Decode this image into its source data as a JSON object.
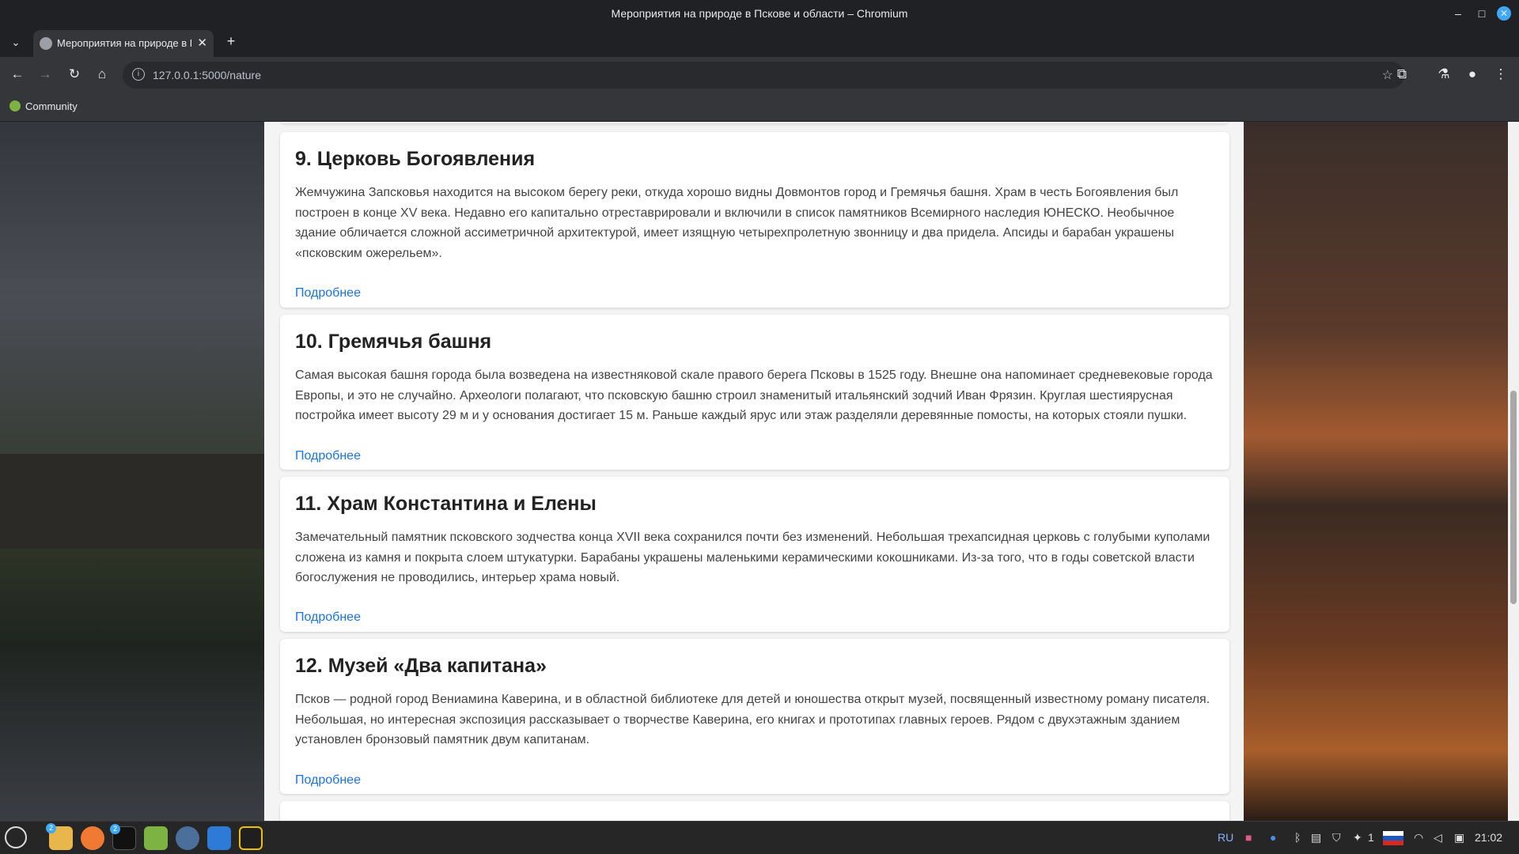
{
  "window": {
    "title": "Мероприятия на природе в Пскове и области – Chromium"
  },
  "tab": {
    "label": "Мероприятия на природе в Пскове и области"
  },
  "toolbar": {
    "url": "127.0.0.1:5000/nature"
  },
  "bookmarks": {
    "community": "Community"
  },
  "cards": [
    {
      "title": "9. Церковь Богоявления",
      "text": "Жемчужина Запсковья находится на высоком берегу реки, откуда хорошо видны Довмонтов город и Гремячья башня. Храм в честь Богоявления был построен в конце XV века. Недавно его капитально отреставрировали и включили в список памятников Всемирного наследия ЮНЕСКО. Необычное здание обличается сложной ассиметричной архитектурой, имеет изящную четырехпролетную звонницу и два придела. Апсиды и барабан украшены «псковским ожерельем».",
      "link": "Подробнее"
    },
    {
      "title": "10. Гремячья башня",
      "text": "Самая высокая башня города была возведена на известняковой скале правого берега Псковы в 1525 году. Внешне она напоминает средневековые города Европы, и это не случайно. Археологи полагают, что псковскую башню строил знаменитый итальянский зодчий Иван Фрязин. Круглая шестиярусная постройка имеет высоту 29 м и у основания достигает 15 м. Раньше каждый ярус или этаж разделяли деревянные помосты, на которых стояли пушки.",
      "link": "Подробнее"
    },
    {
      "title": "11. Храм Константина и Елены",
      "text": "Замечательный памятник псковского зодчества конца XVII века сохранился почти без изменений. Небольшая трехапсидная церковь с голубыми куполами сложена из камня и покрыта слоем штукатурки. Барабаны украшены маленькими керамическими кокошниками. Из-за того, что в годы советской власти богослужения не проводились, интерьер храма новый.",
      "link": "Подробнее"
    },
    {
      "title": "12. Музей «Два капитана»",
      "text": "Псков — родной город Вениамина Каверина, и в областной библиотеке для детей и юношества открыт музей, посвященный известному роману писателя. Небольшая, но интересная экспозиция рассказывает о творчестве Каверина, его книгах и прототипах главных героев. Рядом с двухэтажным зданием установлен бронзовый памятник двум капитанам.",
      "link": "Подробнее"
    }
  ],
  "taskbar": {
    "lang": "RU",
    "clock": "21:02",
    "badge_files": "2",
    "badge_terminal": "2",
    "tray_count": "1"
  },
  "colors": {
    "link": "#1a73e8",
    "page_bg": "#f4f4f4",
    "card_bg": "#ffffff"
  }
}
